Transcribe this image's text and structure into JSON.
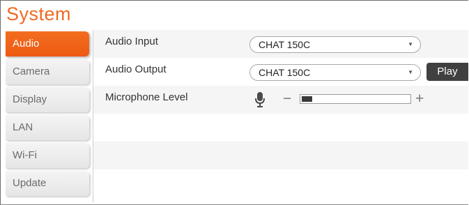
{
  "title": "System",
  "sidebar": {
    "items": [
      {
        "label": "Audio",
        "active": true
      },
      {
        "label": "Camera",
        "active": false
      },
      {
        "label": "Display",
        "active": false
      },
      {
        "label": "LAN",
        "active": false
      },
      {
        "label": "Wi-Fi",
        "active": false
      },
      {
        "label": "Update",
        "active": false
      }
    ]
  },
  "audio": {
    "input_label": "Audio Input",
    "input_value": "CHAT 150C",
    "output_label": "Audio Output",
    "output_value": "CHAT 150C",
    "play_label": "Play",
    "mic_label": "Microphone Level",
    "mic_level_fraction": 0.1,
    "minus_symbol": "−",
    "plus_symbol": "+"
  },
  "icons": {
    "dropdown": "chevron-down-icon",
    "microphone": "microphone-icon"
  },
  "colors": {
    "accent": "#ef6a23",
    "active_tab": "#f26d1f",
    "play_button": "#404040"
  }
}
